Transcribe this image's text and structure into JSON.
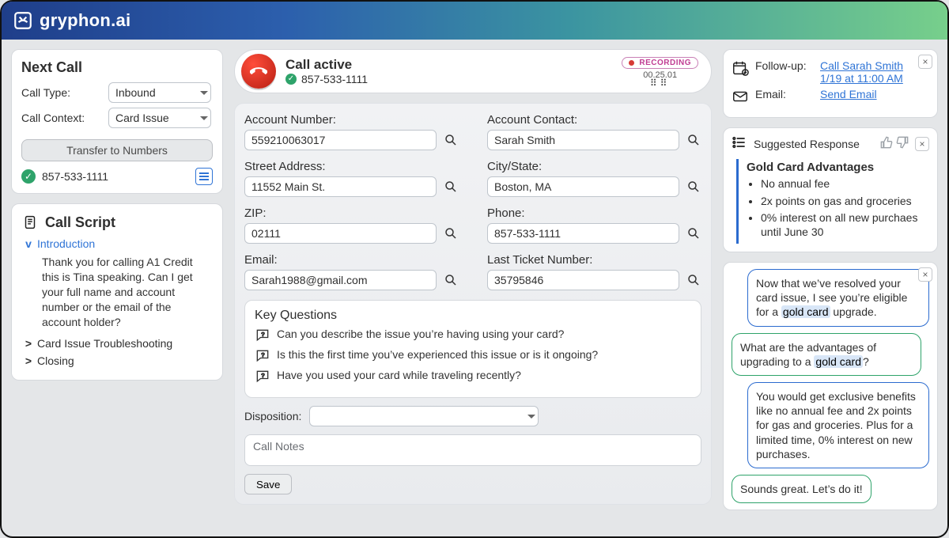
{
  "brand": "gryphon.ai",
  "next_call": {
    "title": "Next Call",
    "type_label": "Call Type:",
    "type_value": "Inbound",
    "context_label": "Call Context:",
    "context_value": "Card Issue",
    "transfer_label": "Transfer to Numbers",
    "phone": "857-533-1111"
  },
  "script": {
    "title": "Call Script",
    "sections": [
      {
        "label": "Introduction",
        "expanded": true,
        "body": "Thank you for calling A1 Credit this is Tina speaking. Can I get your full name and account number or the email of the account holder?"
      },
      {
        "label": "Card Issue Troubleshooting",
        "expanded": false
      },
      {
        "label": "Closing",
        "expanded": false
      }
    ]
  },
  "call": {
    "status": "Call active",
    "phone": "857-533-1111",
    "recording_label": "RECORDING",
    "timer": "00.25.01"
  },
  "account": {
    "number_label": "Account Number:",
    "number": "559210063017",
    "contact_label": "Account Contact:",
    "contact": "Sarah Smith",
    "street_label": "Street Address:",
    "street": "11552 Main St.",
    "city_label": "City/State:",
    "city": "Boston, MA",
    "zip_label": "ZIP:",
    "zip": "02111",
    "phone_label": "Phone:",
    "phone": "857-533-1111",
    "email_label": "Email:",
    "email": "Sarah1988@gmail.com",
    "ticket_label": "Last Ticket Number:",
    "ticket": "35795846"
  },
  "key_questions": {
    "title": "Key Questions",
    "items": [
      "Can you describe the issue you’re having using your card?",
      "Is this the first time you’ve experienced this issue or is it ongoing?",
      "Have you used your card while traveling recently?"
    ]
  },
  "disposition_label": "Disposition:",
  "notes_label": "Call Notes",
  "save_label": "Save",
  "followups": {
    "follow_label": "Follow-up:",
    "follow_link1": "Call Sarah Smith",
    "follow_link2": "1/19 at 11:00 AM",
    "email_label": "Email:",
    "email_link": "Send Email"
  },
  "suggested": {
    "title": "Suggested Response",
    "card_title": "Gold Card Advantages",
    "bullets": [
      "No annual fee",
      "2x points on gas and groceries",
      "0% interest on all new purchaes until June 30"
    ]
  },
  "chat": [
    {
      "role": "agent",
      "text_pre": "Now that we’ve resolved your card issue, I see you’re eligible for a ",
      "hl": "gold card",
      "text_post": " upgrade."
    },
    {
      "role": "cust",
      "text_pre": "What are the advantages of upgrading to a ",
      "hl": "gold card",
      "text_post": "?"
    },
    {
      "role": "agent",
      "text": "You would get exclusive benefits like no annual fee and 2x points for gas and groceries. Plus for a limited time, 0% interest on new purchases."
    },
    {
      "role": "cust",
      "text": "Sounds great. Let’s do it!"
    }
  ]
}
